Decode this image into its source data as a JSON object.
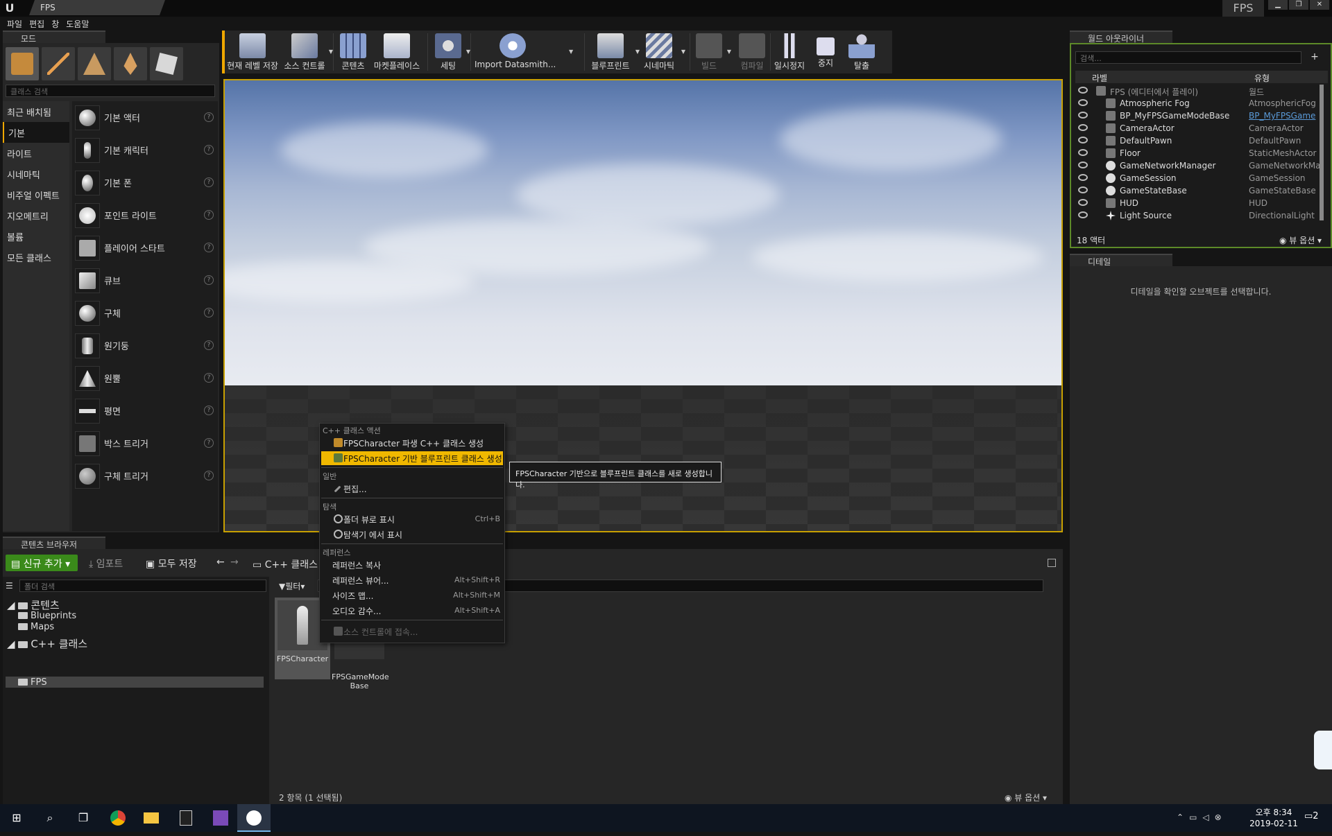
{
  "titlebar": {
    "tab": "FPS",
    "project": "FPS",
    "win_min": "▁",
    "win_max": "❐",
    "win_close": "✕"
  },
  "menu": [
    "파일",
    "편집",
    "창",
    "도움말"
  ],
  "modes": {
    "tab_label": "모드",
    "search_placeholder": "클래스 검색",
    "categories": [
      "최근 배치됨",
      "기본",
      "라이트",
      "시네마틱",
      "비주얼 이펙트",
      "지오메트리",
      "볼륨",
      "모든 클래스"
    ],
    "selected_category": "기본",
    "placeables": [
      "기본 액터",
      "기본 캐릭터",
      "기본 폰",
      "포인트 라이트",
      "플레이어 스타트",
      "큐브",
      "구체",
      "원기둥",
      "원뿔",
      "평면",
      "박스 트리거",
      "구체 트리거"
    ]
  },
  "toolbar": {
    "save": "현재 레벨 저장",
    "source_control": "소스 컨트롤",
    "content": "콘텐츠",
    "marketplace": "마켓플레이스",
    "settings": "세팅",
    "datasmith": "Import Datasmith...",
    "blueprints": "블루프린트",
    "cinematics": "시네마틱",
    "build": "빌드",
    "compile": "컴파일",
    "pause": "일시정지",
    "stop": "중지",
    "eject": "탈출"
  },
  "outliner": {
    "tab_label": "월드 아웃라이너",
    "search_placeholder": "검색...",
    "col_label": "라벨",
    "col_type": "유형",
    "root": {
      "name": "FPS (에디터에서 플레이)",
      "type": "월드"
    },
    "rows": [
      {
        "name": "Atmospheric Fog",
        "type": "AtmosphericFog"
      },
      {
        "name": "BP_MyFPSGameModeBase",
        "type": "BP_MyFPSGame"
      },
      {
        "name": "CameraActor",
        "type": "CameraActor"
      },
      {
        "name": "DefaultPawn",
        "type": "DefaultPawn"
      },
      {
        "name": "Floor",
        "type": "StaticMeshActor"
      },
      {
        "name": "GameNetworkManager",
        "type": "GameNetworkMar"
      },
      {
        "name": "GameSession",
        "type": "GameSession"
      },
      {
        "name": "GameStateBase",
        "type": "GameStateBase"
      },
      {
        "name": "HUD",
        "type": "HUD"
      },
      {
        "name": "Light Source",
        "type": "DirectionalLight"
      }
    ],
    "count": "18 액터",
    "view_options": "뷰 옵션"
  },
  "details": {
    "tab_label": "디테일",
    "empty_message": "디테일을 확인할 오브젝트를 선택합니다."
  },
  "content_browser": {
    "tab_label": "콘텐츠 브라우저",
    "add_new": "신규 추가",
    "import": "임포트",
    "save_all": "모두 저장",
    "path": "C++ 클래스",
    "folder_search_placeholder": "폴더 검색",
    "filter": "필터",
    "tree": {
      "content_root": "콘텐츠",
      "content_children": [
        "Blueprints",
        "Maps"
      ],
      "cpp_root": "C++ 클래스",
      "cpp_children": [
        "FPS"
      ]
    },
    "assets": [
      "FPSCharacter",
      "FPSGameMode\nBase"
    ],
    "item_count": "2 항목 (1 선택됨)",
    "view_options": "뷰 옵션"
  },
  "context_menu": {
    "section_cpp": "C++ 클래스 액션",
    "create_cpp": "FPSCharacter 파생 C++ 클래스 생성",
    "create_bp": "FPSCharacter 기반 블루프린트 클래스 생성",
    "section_common": "일반",
    "edit": "편집...",
    "section_explore": "탐색",
    "show_folder_view": "폴더 뷰로 표시",
    "show_folder_view_sc": "Ctrl+B",
    "show_explorer": "탐색기 에서 표시",
    "section_refs": "레퍼런스",
    "copy_ref": "레퍼런스 복사",
    "ref_viewer": "레퍼런스 뷰어...",
    "ref_viewer_sc": "Alt+Shift+R",
    "size_map": "사이즈 맵...",
    "size_map_sc": "Alt+Shift+M",
    "audit": "오디오 감수...",
    "audit_sc": "Alt+Shift+A",
    "source_control": "소스 컨트롤에 접속..."
  },
  "tooltip": "FPSCharacter 기반으로 블루프린트 클래스를 새로 생성합니다.",
  "taskbar": {
    "time": "오후 8:34",
    "date": "2019-02-11",
    "notif": "2"
  }
}
